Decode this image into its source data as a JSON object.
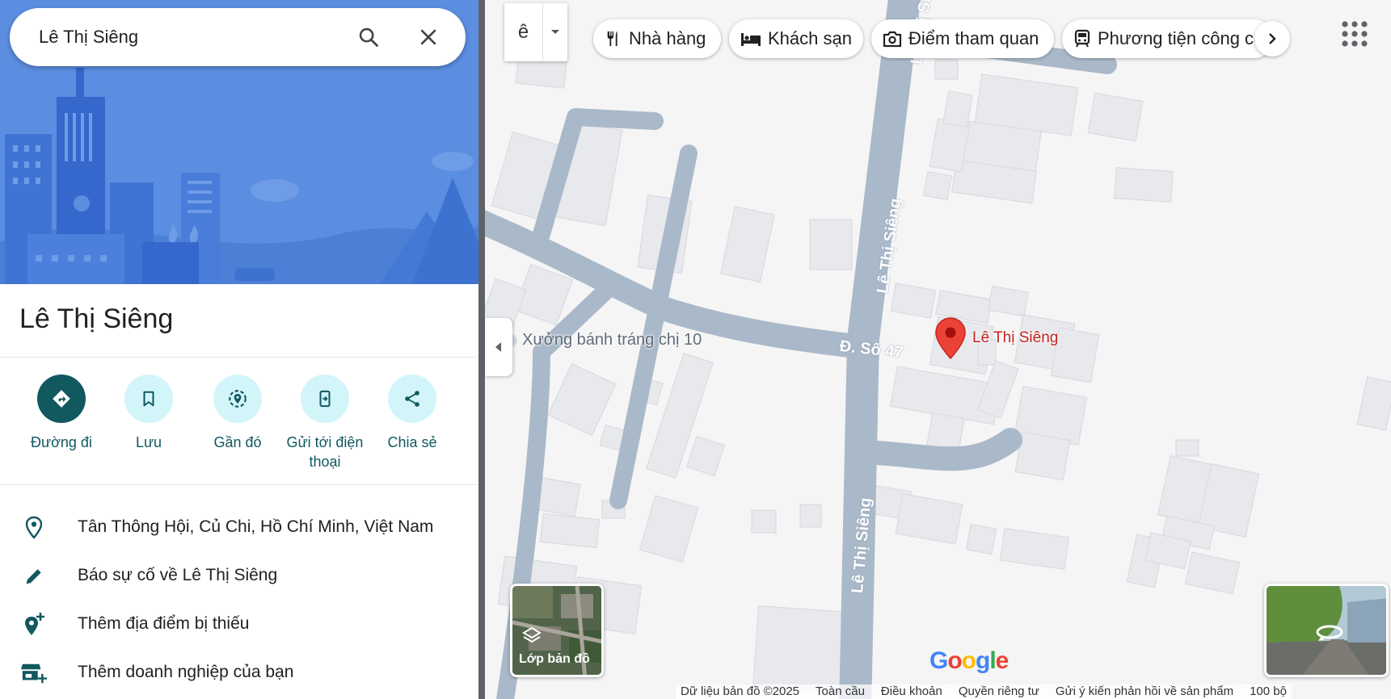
{
  "search": {
    "value": "Lê Thị Siêng"
  },
  "place": {
    "title": "Lê Thị Siêng"
  },
  "actions": [
    {
      "label": "Đường đi"
    },
    {
      "label": "Lưu"
    },
    {
      "label": "Gần đó"
    },
    {
      "label": "Gửi tới điện thoại"
    },
    {
      "label": "Chia sẻ"
    }
  ],
  "info_rows": [
    {
      "text": "Tân Thông Hội, Củ Chi, Hồ Chí Minh, Việt Nam",
      "icon": "location-pin-icon"
    },
    {
      "text": "Báo sự cố về Lê Thị Siêng",
      "icon": "pencil-icon"
    },
    {
      "text": "Thêm địa điểm bị thiếu",
      "icon": "add-location-icon"
    },
    {
      "text": "Thêm doanh nghiệp của bạn",
      "icon": "add-business-icon"
    }
  ],
  "map": {
    "language_button": "ê",
    "chips": [
      "Nhà hàng",
      "Khách sạn",
      "Điểm tham quan",
      "Phương tiện công cộng"
    ],
    "road_labels": [
      "Lê Thị Siêng",
      "Lê Thị Siêng",
      "Lê Thị Siêng",
      "Đ. Số 47"
    ],
    "poi_label": "Xưởng bánh tráng chị 10",
    "pin_label": "Lê Thị Siêng",
    "layer_label": "Lớp bản đồ",
    "logo": "Google",
    "footer": [
      "Dữ liệu bản đồ ©2025",
      "Toàn cầu",
      "Điều khoản",
      "Quyền riêng tư",
      "Gửi ý kiến phản hồi về sản phẩm",
      "100 bộ"
    ]
  },
  "colors": {
    "accent": "#11585f",
    "pin": "#ea4335",
    "road": "#aab9c9",
    "building": "#e8e9ed"
  }
}
